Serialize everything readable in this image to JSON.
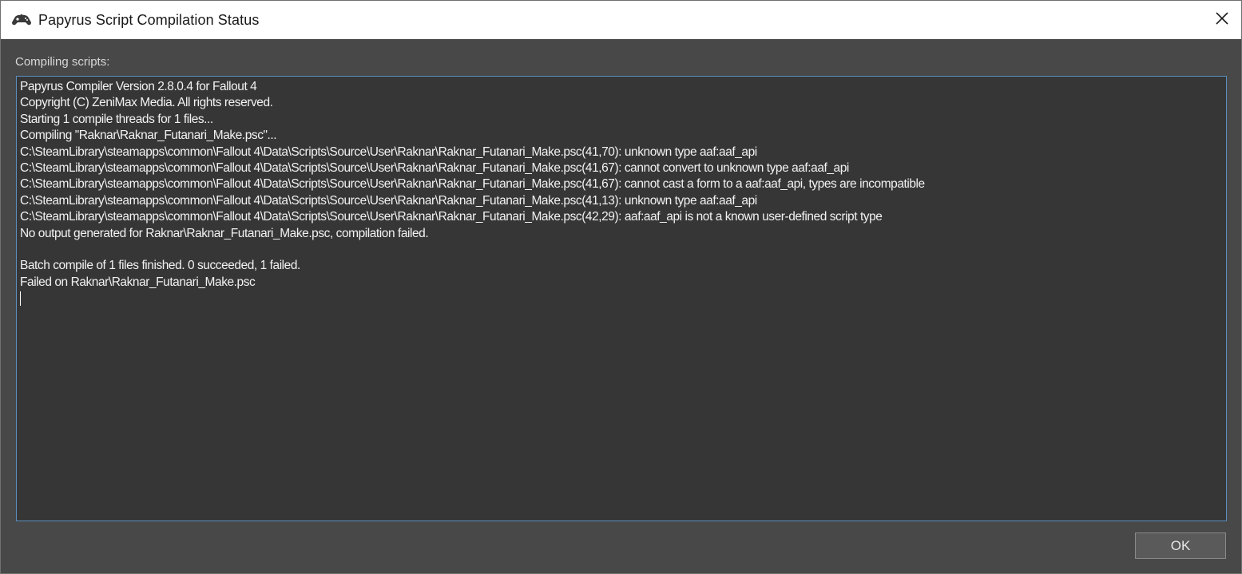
{
  "window": {
    "title": "Papyrus Script Compilation Status",
    "icon": "gamepad-icon",
    "close_icon": "close-icon"
  },
  "main": {
    "label": "Compiling scripts:",
    "output_lines": [
      "Papyrus Compiler Version 2.8.0.4 for Fallout 4",
      "Copyright (C) ZeniMax Media. All rights reserved.",
      "Starting 1 compile threads for 1 files...",
      "Compiling \"Raknar\\Raknar_Futanari_Make.psc\"...",
      "C:\\SteamLibrary\\steamapps\\common\\Fallout 4\\Data\\Scripts\\Source\\User\\Raknar\\Raknar_Futanari_Make.psc(41,70): unknown type aaf:aaf_api",
      "C:\\SteamLibrary\\steamapps\\common\\Fallout 4\\Data\\Scripts\\Source\\User\\Raknar\\Raknar_Futanari_Make.psc(41,67): cannot convert to unknown type aaf:aaf_api",
      "C:\\SteamLibrary\\steamapps\\common\\Fallout 4\\Data\\Scripts\\Source\\User\\Raknar\\Raknar_Futanari_Make.psc(41,67): cannot cast a form to a aaf:aaf_api, types are incompatible",
      "C:\\SteamLibrary\\steamapps\\common\\Fallout 4\\Data\\Scripts\\Source\\User\\Raknar\\Raknar_Futanari_Make.psc(41,13): unknown type aaf:aaf_api",
      "C:\\SteamLibrary\\steamapps\\common\\Fallout 4\\Data\\Scripts\\Source\\User\\Raknar\\Raknar_Futanari_Make.psc(42,29): aaf:aaf_api is not a known user-defined script type",
      "No output generated for Raknar\\Raknar_Futanari_Make.psc, compilation failed.",
      "",
      "Batch compile of 1 files finished. 0 succeeded, 1 failed.",
      "Failed on Raknar\\Raknar_Futanari_Make.psc"
    ]
  },
  "footer": {
    "ok_label": "OK"
  }
}
